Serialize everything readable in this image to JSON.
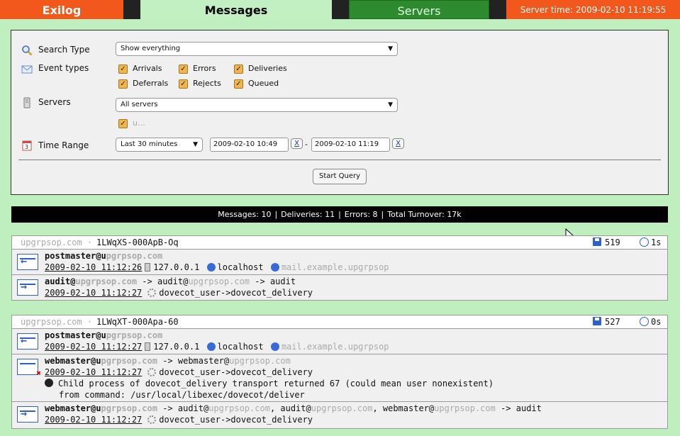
{
  "nav": {
    "brand": "Exilog",
    "tab_messages": "Messages",
    "tab_servers": "Servers",
    "server_time": "Server time: 2009-02-10 11:19:55"
  },
  "query": {
    "search_type_label": "Search Type",
    "search_type_value": "Show everything",
    "event_types_label": "Event types",
    "event_types": [
      "Arrivals",
      "Errors",
      "Deliveries",
      "Deferrals",
      "Rejects",
      "Queued"
    ],
    "servers_label": "Servers",
    "servers_value": "All servers",
    "server_checkbox_label": "u…",
    "time_range_label": "Time Range",
    "time_range_value": "Last 30 minutes",
    "from_time": "2009-02-10 10:49",
    "to_time": "2009-02-10 11:19",
    "clear_label": "X",
    "range_dash": "-",
    "start_button": "Start Query"
  },
  "summary": {
    "messages": "Messages: 10",
    "deliveries": "Deliveries: 11",
    "errors": "Errors: 8",
    "turnover": "Total Turnover: 17k",
    "pipe": "|"
  },
  "messages": [
    {
      "host": "upgrpsop.com ·",
      "id": "1LWqXS-000ApB-Oq",
      "size": "519",
      "duration": "1s",
      "entries": [
        {
          "type": "arrival",
          "sender": "postmaster@u",
          "sender_blur": "pgrpsop.com",
          "timestamp": "2009-02-10 11:12:26",
          "ip": "127.0.0.1",
          "host": "localhost",
          "helo_blur": "mail.example.upgrpsop"
        },
        {
          "type": "delivery",
          "sender": "audit@",
          "sender_blur": "upgrpsop.com",
          "recipients": "-> audit@",
          "recipients_blur": "upgrpsop.com",
          "target": "-> audit",
          "timestamp": "2009-02-10 11:12:27",
          "transport": "dovecot_user->dovecot_delivery"
        }
      ]
    },
    {
      "host": "upgrpsop.com ·",
      "id": "1LWqXT-000Apa-60",
      "size": "527",
      "duration": "0s",
      "entries": [
        {
          "type": "arrival",
          "sender": "postmaster@u",
          "sender_blur": "pgrpsop.com",
          "timestamp": "2009-02-10 11:12:27",
          "ip": "127.0.0.1",
          "host": "localhost",
          "helo_blur": "mail.example.upgrpsop"
        },
        {
          "type": "error",
          "sender": "webmaster@u",
          "sender_blur": "pgrpsop.com",
          "recipients": "-> webmaster@",
          "recipients_blur": "upgrpsop.com",
          "timestamp": "2009-02-10 11:12:27",
          "transport": "dovecot_user->dovecot_delivery",
          "error_line1": "Child process of dovecot_delivery transport returned 67 (could mean user nonexistent)",
          "error_line2": "from command: /usr/local/libexec/dovecot/deliver"
        },
        {
          "type": "delivery",
          "sender": "webmaster@u",
          "sender_blur": "pgrpsop.com",
          "recipients": "-> audit@",
          "recipients_blur": "upgrpsop.com",
          "recipients2": ", audit@",
          "recipients2_blur": "upgrpsop.com",
          "recipients3": ", webmaster@",
          "recipients3_blur": "upgrpsop.com",
          "target": "-> audit",
          "timestamp": "2009-02-10 11:12:27",
          "transport": "dovecot_user->dovecot_delivery"
        }
      ]
    }
  ]
}
